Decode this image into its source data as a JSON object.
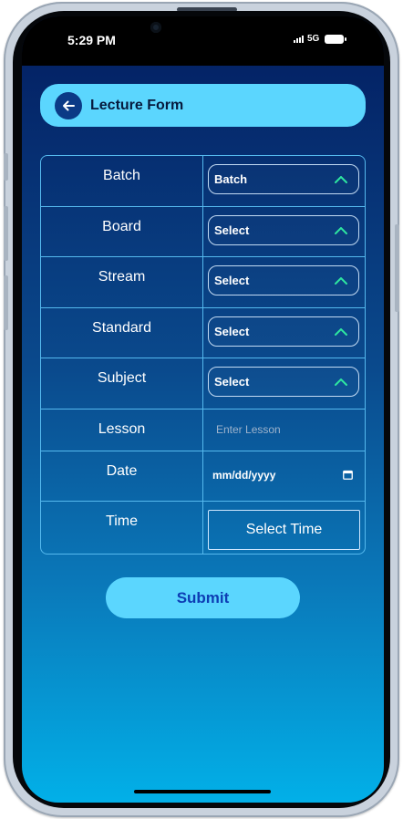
{
  "status_bar": {
    "time": "5:29 PM",
    "network": "5G"
  },
  "header": {
    "title": "Lecture Form"
  },
  "form": {
    "rows": [
      {
        "label": "Batch",
        "value": "Batch"
      },
      {
        "label": "Board",
        "value": "Select"
      },
      {
        "label": "Stream",
        "value": "Select"
      },
      {
        "label": "Standard",
        "value": "Select"
      },
      {
        "label": "Subject",
        "value": "Select"
      },
      {
        "label": "Lesson",
        "placeholder": "Enter Lesson"
      },
      {
        "label": "Date",
        "value": "mm/dd/yyyy"
      },
      {
        "label": "Time",
        "value": "Select Time"
      }
    ]
  },
  "submit_label": "Submit",
  "colors": {
    "accent": "#5bd6fe",
    "chevron": "#2ee6a0",
    "background_top": "#031d60",
    "background_bottom": "#02b0e8"
  }
}
